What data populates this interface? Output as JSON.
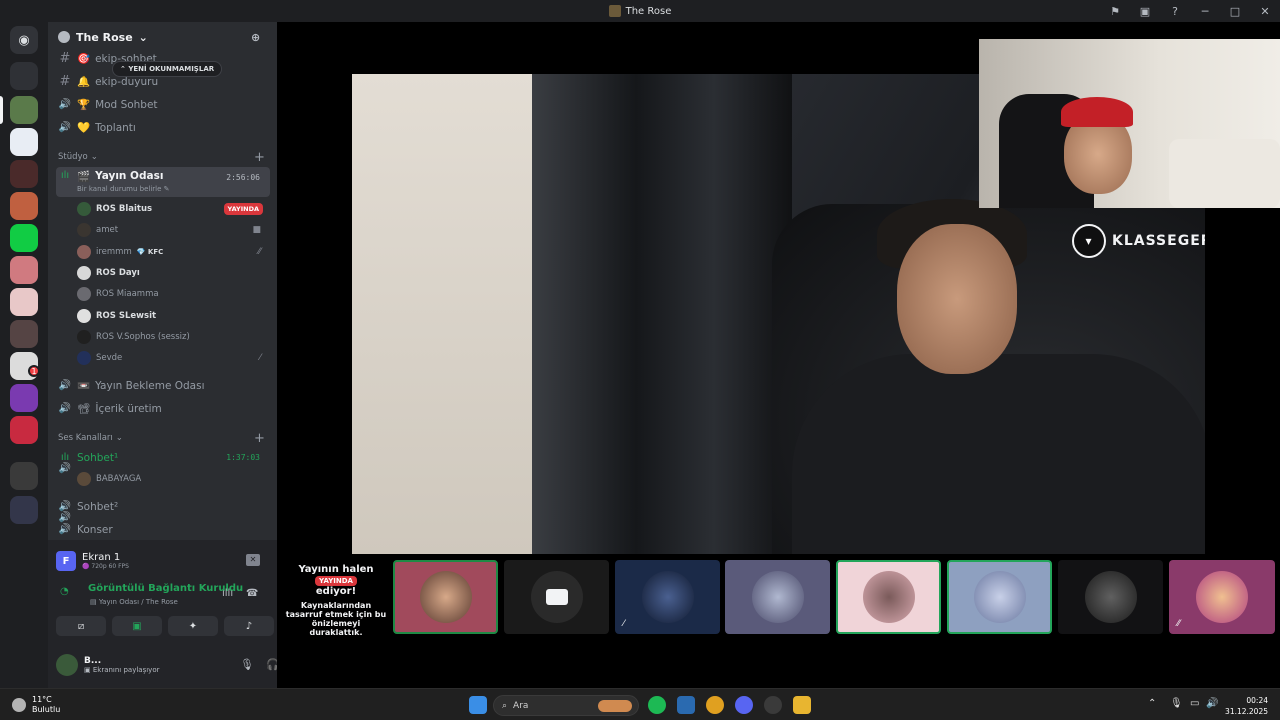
{
  "window": {
    "title": "The Rose"
  },
  "server": {
    "name": "The Rose",
    "new_unread": "YENİ OKUNMAMIŞLAR"
  },
  "channels_top": [
    {
      "name": "ekip-sohbet",
      "emoji": "🎯",
      "type": "text"
    },
    {
      "name": "ekip-duyuru",
      "emoji": "🔔",
      "type": "text"
    },
    {
      "name": "Mod Sohbet",
      "emoji": "🏆",
      "type": "voice"
    },
    {
      "name": "Toplantı",
      "emoji": "💛",
      "type": "voice"
    }
  ],
  "category_studio": {
    "name": "Stüdyo"
  },
  "live_channel": {
    "name": "Yayın Odası",
    "emoji": "🎬",
    "timer": "2:56:06",
    "status": "Bir kanal durumu belirle"
  },
  "members": [
    {
      "name": "ROS Blaitus",
      "badge": "YAYINDA",
      "bright": true
    },
    {
      "name": "amet",
      "bright": false
    },
    {
      "name": "iremmm",
      "tag": "KFC",
      "bright": false
    },
    {
      "name": "ROS Dayı",
      "bright": true
    },
    {
      "name": "ROS Miaamma",
      "bright": false
    },
    {
      "name": "ROS SLewsit",
      "bright": true
    },
    {
      "name": "ROS V.Sophos (sessiz)",
      "bright": false
    },
    {
      "name": "Sevde",
      "bright": false
    }
  ],
  "channels_mid": [
    {
      "name": "Yayın Bekleme Odası",
      "emoji": "📼"
    },
    {
      "name": "İçerik üretim",
      "emoji": "📽"
    }
  ],
  "category_voice": {
    "name": "Ses Kanalları"
  },
  "voice_channels": [
    {
      "name": "Sohbet¹",
      "timer": "1:37:03",
      "active": true
    },
    {
      "name": "Sohbet²",
      "active": false
    },
    {
      "name": "Konser",
      "active": false
    }
  ],
  "voice_member": "BABAYAGA",
  "screen": {
    "title": "Ekran 1",
    "quality": "720p 60 FPS"
  },
  "connection": {
    "status": "Görüntülü Bağlantı Kuruldu",
    "location": "Yayın Odası / The Rose"
  },
  "me": {
    "name": "B...",
    "status": "Ekranını paylaşıyor"
  },
  "stream_offline": {
    "title": "Yayının halen",
    "badge": "YAYINDA",
    "title2": "ediyor!",
    "text": "Kaynaklarından tasarruf etmek için bu önizlemeyi duraklattık."
  },
  "watermark": "KLASSEGER",
  "taskbar": {
    "temp": "11°C",
    "weather": "Bulutlu",
    "search": "Ara",
    "time": "00:24",
    "date": "31.12.2025"
  },
  "colors": {
    "accent": "#5865f2",
    "green": "#23a55a",
    "red": "#da373c"
  }
}
